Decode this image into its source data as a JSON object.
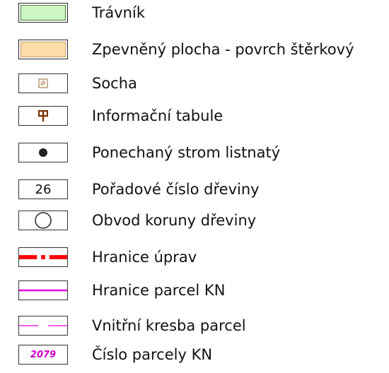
{
  "legend": {
    "items": [
      {
        "label": "Trávník",
        "symbol": "green-fill-box"
      },
      {
        "label": "Zpevněný plocha - povrch štěrkový",
        "symbol": "beige-fill-box"
      },
      {
        "label": "Socha",
        "symbol": "statue-icon"
      },
      {
        "label": "Informační tabule",
        "symbol": "info-board-icon",
        "glyph": "ᵖ"
      },
      {
        "label": "Ponechaný strom listnatý",
        "symbol": "filled-dot"
      },
      {
        "label": "Pořadové číslo dřeviny",
        "symbol": "number",
        "value": "26"
      },
      {
        "label": "Obvod koruny dřeviny",
        "symbol": "circle-outline"
      },
      {
        "label": "Hranice úprav",
        "symbol": "red-dash-dot-line"
      },
      {
        "label": "Hranice parcel KN",
        "symbol": "magenta-solid-line"
      },
      {
        "label": "Vnitřní kresba parcel",
        "symbol": "magenta-dashed-line"
      },
      {
        "label": "Číslo parcely KN",
        "symbol": "parcel-number",
        "value": "2079"
      }
    ]
  },
  "colors": {
    "lawn_fill": "#ccf5c2",
    "gravel_fill": "#fddcaa",
    "boundary_red": "#ff0000",
    "parcel_magenta": "#e000e0",
    "info_brown": "#7a2e00"
  }
}
